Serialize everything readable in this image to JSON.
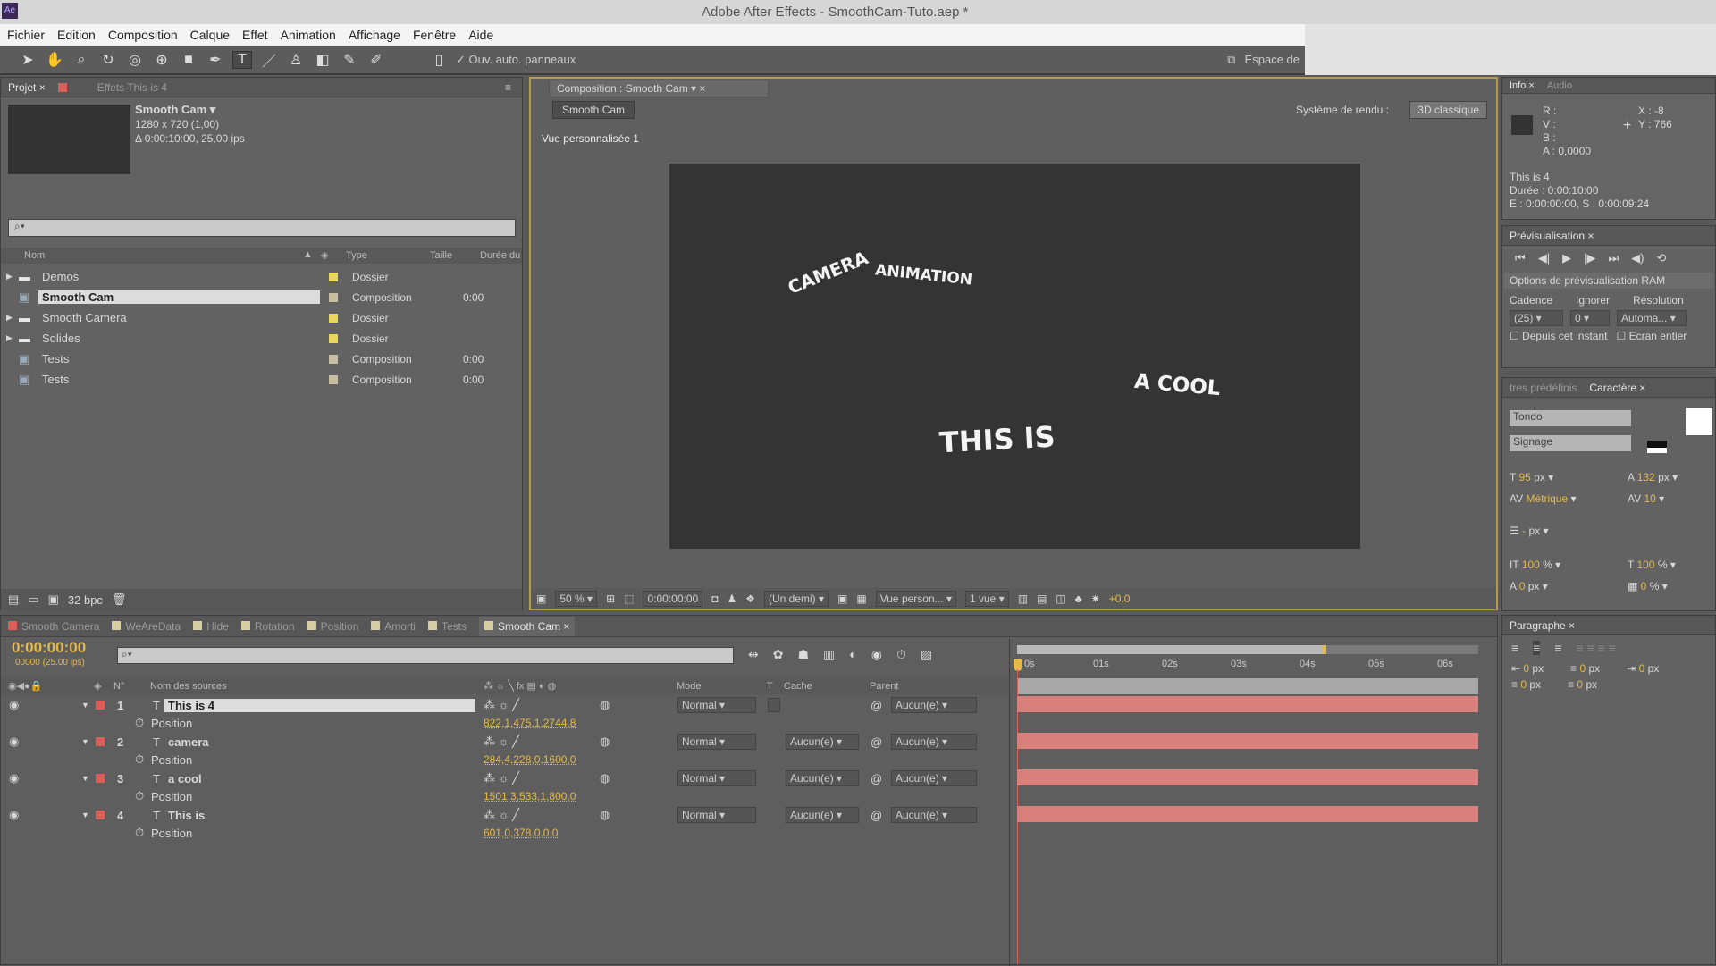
{
  "window": {
    "title": "Adobe After Effects - SmoothCam-Tuto.aep *",
    "app_icon": "Ae"
  },
  "menu": [
    "Fichier",
    "Edition",
    "Composition",
    "Calque",
    "Effet",
    "Animation",
    "Affichage",
    "Fenêtre",
    "Aide"
  ],
  "toolbar": {
    "auto_open_label": "Ouv. auto. panneaux",
    "workspace_label": "Espace de"
  },
  "project": {
    "tabs": [
      "Projet",
      "Effets This is 4"
    ],
    "selected": {
      "name": "Smooth Cam ▾",
      "dims": "1280 x 720 (1,00)",
      "duration": "Δ 0:00:10:00, 25,00 ips"
    },
    "columns": [
      "Nom",
      "Type",
      "Taille",
      "Durée du"
    ],
    "items": [
      {
        "name": "Demos",
        "type": "Dossier",
        "duration": "",
        "folder": true,
        "label": "#e8d75a"
      },
      {
        "name": "Smooth Cam",
        "type": "Composition",
        "duration": "0:00",
        "folder": false,
        "label": "#c8bfa0",
        "selected": true
      },
      {
        "name": "Smooth Camera",
        "type": "Dossier",
        "duration": "",
        "folder": true,
        "label": "#e8d75a"
      },
      {
        "name": "Solides",
        "type": "Dossier",
        "duration": "",
        "folder": true,
        "label": "#e8d75a"
      },
      {
        "name": "Tests",
        "type": "Composition",
        "duration": "0:00",
        "folder": false,
        "label": "#c8bfa0"
      },
      {
        "name": "Tests",
        "type": "Composition",
        "duration": "0:00",
        "folder": false,
        "label": "#c8bfa0"
      }
    ],
    "bpc": "32 bpc"
  },
  "comp": {
    "tab": "Composition : Smooth Cam",
    "breadcrumb": "Smooth Cam",
    "renderer_label": "Système de rendu :",
    "renderer": "3D classique",
    "view_label": "Vue personnalisée 1",
    "texts": [
      "CAMERA",
      "ANIMATION",
      "A COOL",
      "THIS IS"
    ],
    "footer": {
      "zoom": "50 %",
      "time": "0:00:00:00",
      "resolution": "(Un demi)",
      "view": "Vue person...",
      "views": "1 vue",
      "exposure": "+0,0"
    }
  },
  "info": {
    "tabs": [
      "Info",
      "Audio"
    ],
    "r": "R :",
    "v": "V :",
    "b": "B :",
    "a": "A : 0,0000",
    "x": "X : -8",
    "y": "Y : 766",
    "layer": "This is 4",
    "duration": "Durée : 0:00:10:00",
    "io": "E : 0:00:00:00, S : 0:00:09:24"
  },
  "preview": {
    "tab": "Prévisualisation",
    "ram_options": "Options de prévisualisation RAM",
    "cadence_label": "Cadence",
    "ignore_label": "Ignorer",
    "resolution_label": "Résolution",
    "cadence": "(25)",
    "ignore": "0",
    "resolution": "Automa...",
    "from_current": "Depuis cet instant",
    "fullscreen": "Ecran entier"
  },
  "character": {
    "tabs": [
      "tres prédéfinis",
      "Caractère"
    ],
    "font": "Tondo",
    "style": "Signage",
    "size": "95",
    "size_unit": "px",
    "leading": "132",
    "leading_unit": "px",
    "kerning": "Métrique",
    "tracking": "10",
    "stroke": "-",
    "stroke_unit": "px",
    "vscale": "100",
    "hscale": "100",
    "pct": "%",
    "baseline": "0",
    "baseline_unit": "px",
    "tsume": "0"
  },
  "paragraph": {
    "tab": "Paragraphe",
    "values": [
      "0",
      "0",
      "0",
      "0",
      "0"
    ],
    "unit": "px"
  },
  "timeline": {
    "tabs": [
      {
        "label": "Smooth Camera",
        "color": "#d9605a"
      },
      {
        "label": "WeAreData",
        "color": "#d6cfa6"
      },
      {
        "label": "Hide",
        "color": "#d6cfa6"
      },
      {
        "label": "Rotation",
        "color": "#d6cfa6"
      },
      {
        "label": "Position",
        "color": "#d6cfa6"
      },
      {
        "label": "Amorti",
        "color": "#d6cfa6"
      },
      {
        "label": "Tests",
        "color": "#d6cfa6"
      },
      {
        "label": "Smooth Cam",
        "color": "#d6cfa6",
        "active": true
      }
    ],
    "time": "0:00:00:00",
    "frames": "00000 (25.00 ips)",
    "columns": {
      "num": "N°",
      "source": "Nom des sources",
      "mode": "Mode",
      "t": "T",
      "matte": "Cache",
      "parent": "Parent"
    },
    "ruler": [
      "0s",
      "01s",
      "02s",
      "03s",
      "04s",
      "05s",
      "06s"
    ],
    "layers": [
      {
        "num": "1",
        "name": "This is 4",
        "mode": "Normal",
        "matte": "",
        "parent": "Aucun(e)",
        "prop": "Position",
        "value": "822,1,475,1,2744,8",
        "editing": true
      },
      {
        "num": "2",
        "name": "camera",
        "mode": "Normal",
        "matte": "Aucun(e)",
        "parent": "Aucun(e)",
        "prop": "Position",
        "value": "284,4,228,0,1600,0"
      },
      {
        "num": "3",
        "name": "a cool",
        "mode": "Normal",
        "matte": "Aucun(e)",
        "parent": "Aucun(e)",
        "prop": "Position",
        "value": "1501,3,533,1,800,0"
      },
      {
        "num": "4",
        "name": "This is",
        "mode": "Normal",
        "matte": "Aucun(e)",
        "parent": "Aucun(e)",
        "prop": "Position",
        "value": "601,0,378,0,0,0"
      }
    ]
  },
  "colors": {
    "accent": "#e5b94b",
    "layer_bar": "#d9807d",
    "label_red": "#d9605a"
  }
}
